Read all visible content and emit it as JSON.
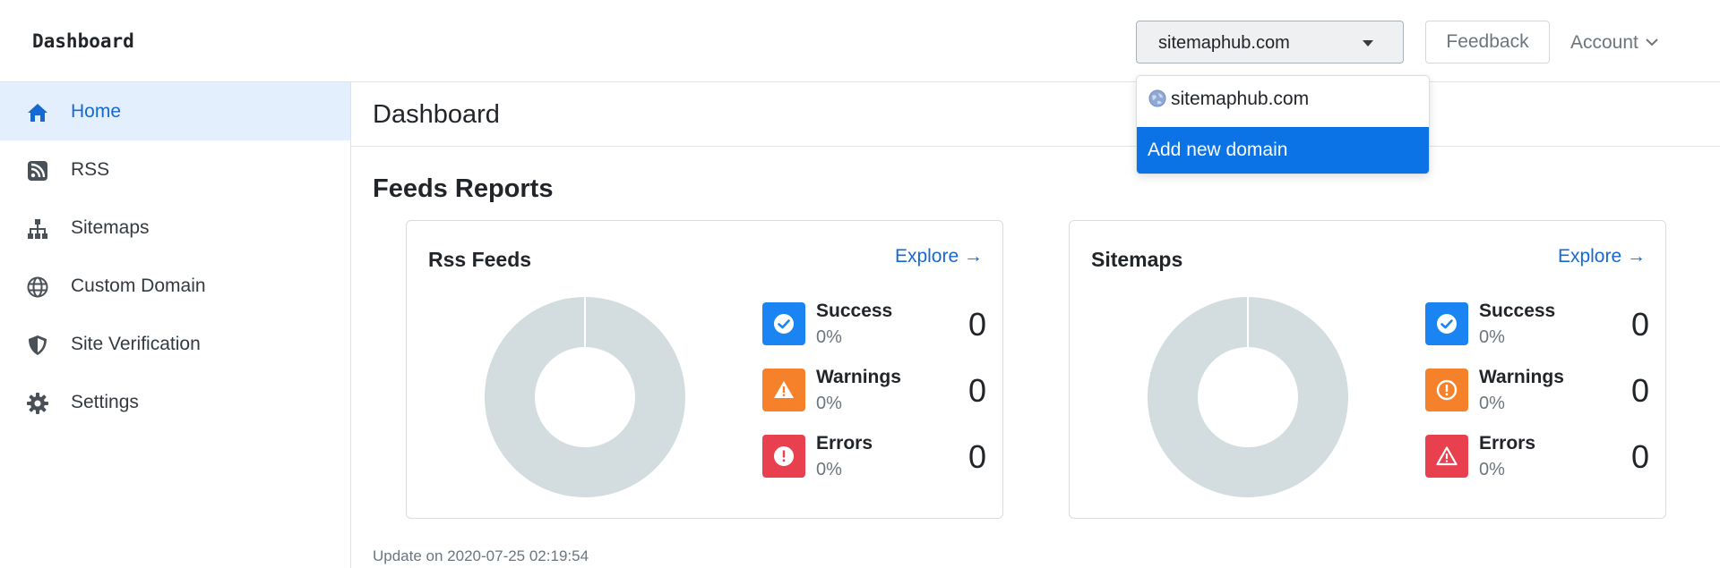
{
  "header": {
    "brand": "Dashboard",
    "domain_selected": "sitemaphub.com",
    "feedback_label": "Feedback",
    "account_label": "Account"
  },
  "domain_dropdown": {
    "options": [
      "sitemaphub.com",
      "Add new domain"
    ],
    "highlighted": "Add new domain"
  },
  "sidebar": {
    "items": [
      {
        "label": "Home",
        "icon": "home-icon",
        "active": true
      },
      {
        "label": "RSS",
        "icon": "rss-icon"
      },
      {
        "label": "Sitemaps",
        "icon": "sitemap-icon"
      },
      {
        "label": "Custom Domain",
        "icon": "globe-icon"
      },
      {
        "label": "Site Verification",
        "icon": "shield-icon"
      },
      {
        "label": "Settings",
        "icon": "gear-icon"
      }
    ]
  },
  "main": {
    "page_title": "Dashboard",
    "section_title": "Feeds Reports",
    "update_text": "Update on 2020-07-25 02:19:54"
  },
  "cards": [
    {
      "title": "Rss Feeds",
      "explore_label": "Explore →",
      "stats": [
        {
          "name": "Success",
          "pct": "0%",
          "count": "0",
          "icon": "check-circle-icon"
        },
        {
          "name": "Warnings",
          "pct": "0%",
          "count": "0",
          "icon": "warning-triangle-icon"
        },
        {
          "name": "Errors",
          "pct": "0%",
          "count": "0",
          "icon": "error-circle-icon"
        }
      ]
    },
    {
      "title": "Sitemaps",
      "explore_label": "Explore →",
      "stats": [
        {
          "name": "Success",
          "pct": "0%",
          "count": "0",
          "icon": "check-circle-icon"
        },
        {
          "name": "Warnings",
          "pct": "0%",
          "count": "0",
          "icon": "exclamation-circle-icon"
        },
        {
          "name": "Errors",
          "pct": "0%",
          "count": "0",
          "icon": "warning-triangle-icon"
        }
      ]
    }
  ],
  "colors": {
    "accent": "#1769d2",
    "success": "#1a84f2",
    "warning": "#f5822b",
    "error": "#e8404f",
    "donut_empty": "#d3dde0",
    "dropdown_highlight": "#0b73e6"
  }
}
